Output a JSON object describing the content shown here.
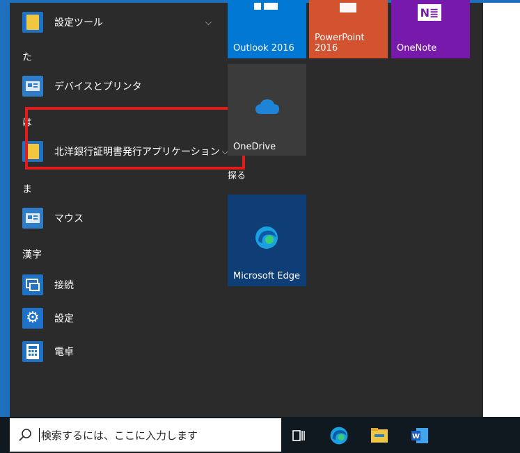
{
  "applist": {
    "items": [
      {
        "type": "app",
        "label": "設定ツール",
        "icon": "folder-icon",
        "expanded": false
      },
      {
        "type": "header",
        "label": "た"
      },
      {
        "type": "app",
        "label": "デバイスとプリンタ",
        "icon": "control-panel-icon"
      },
      {
        "type": "header",
        "label": "は"
      },
      {
        "type": "app",
        "label": "北洋銀行証明書発行アプリケーション",
        "icon": "folder-icon",
        "expanded": false
      },
      {
        "type": "header",
        "label": "ま"
      },
      {
        "type": "app",
        "label": "マウス",
        "icon": "control-panel-icon"
      },
      {
        "type": "header",
        "label": "漢字"
      },
      {
        "type": "app",
        "label": "接続",
        "icon": "connect-icon"
      },
      {
        "type": "app",
        "label": "設定",
        "icon": "gear-icon"
      },
      {
        "type": "app",
        "label": "電卓",
        "icon": "calculator-icon"
      }
    ]
  },
  "tiles": {
    "outlook": "Outlook 2016",
    "powerpoint_line1": "PowerPoint",
    "powerpoint_line2": "2016",
    "onenote": "OneNote",
    "onedrive": "OneDrive",
    "group": "探る",
    "edge": "Microsoft Edge"
  },
  "taskbar": {
    "search_placeholder": "検索するには、ここに入力します",
    "icons": [
      "task-view-icon",
      "edge-icon",
      "file-explorer-icon",
      "word-icon"
    ]
  },
  "colors": {
    "start_bg": "#2b2b2b",
    "accent": "#1f6fbf",
    "highlight_box": "#e21b1b",
    "outlook_tile": "#0078d4",
    "powerpoint_tile": "#d35230",
    "onenote_tile": "#7719aa"
  }
}
